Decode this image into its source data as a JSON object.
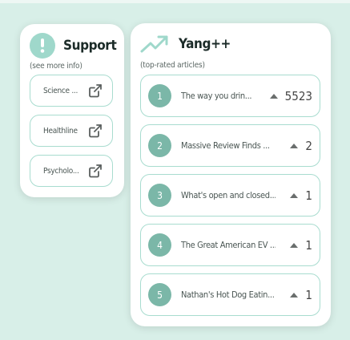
{
  "support": {
    "title": "Support",
    "subtitle": "(see more info)",
    "links": [
      {
        "label": "Science ..."
      },
      {
        "label": "Healthline"
      },
      {
        "label": "Psycholo..."
      }
    ]
  },
  "yang": {
    "title": "Yang++",
    "subtitle": "(top-rated articles)",
    "articles": [
      {
        "rank": "1",
        "title": "The way you drin...",
        "votes": "5523"
      },
      {
        "rank": "2",
        "title": "Massive Review Finds ...",
        "votes": "2"
      },
      {
        "rank": "3",
        "title": "What's open and closed...",
        "votes": "1"
      },
      {
        "rank": "4",
        "title": "The Great American EV ...",
        "votes": "1"
      },
      {
        "rank": "5",
        "title": "Nathan's Hot Dog Eatin...",
        "votes": "1"
      }
    ]
  },
  "colors": {
    "accent": "#7bb7a8",
    "accent_light": "#9fd8cb",
    "border": "#a8dccf",
    "background": "#d8efe8"
  },
  "icons": {
    "support": "exclamation-circle-icon",
    "yang": "trending-up-icon",
    "link": "external-link-icon",
    "vote": "upvote-triangle-icon"
  }
}
